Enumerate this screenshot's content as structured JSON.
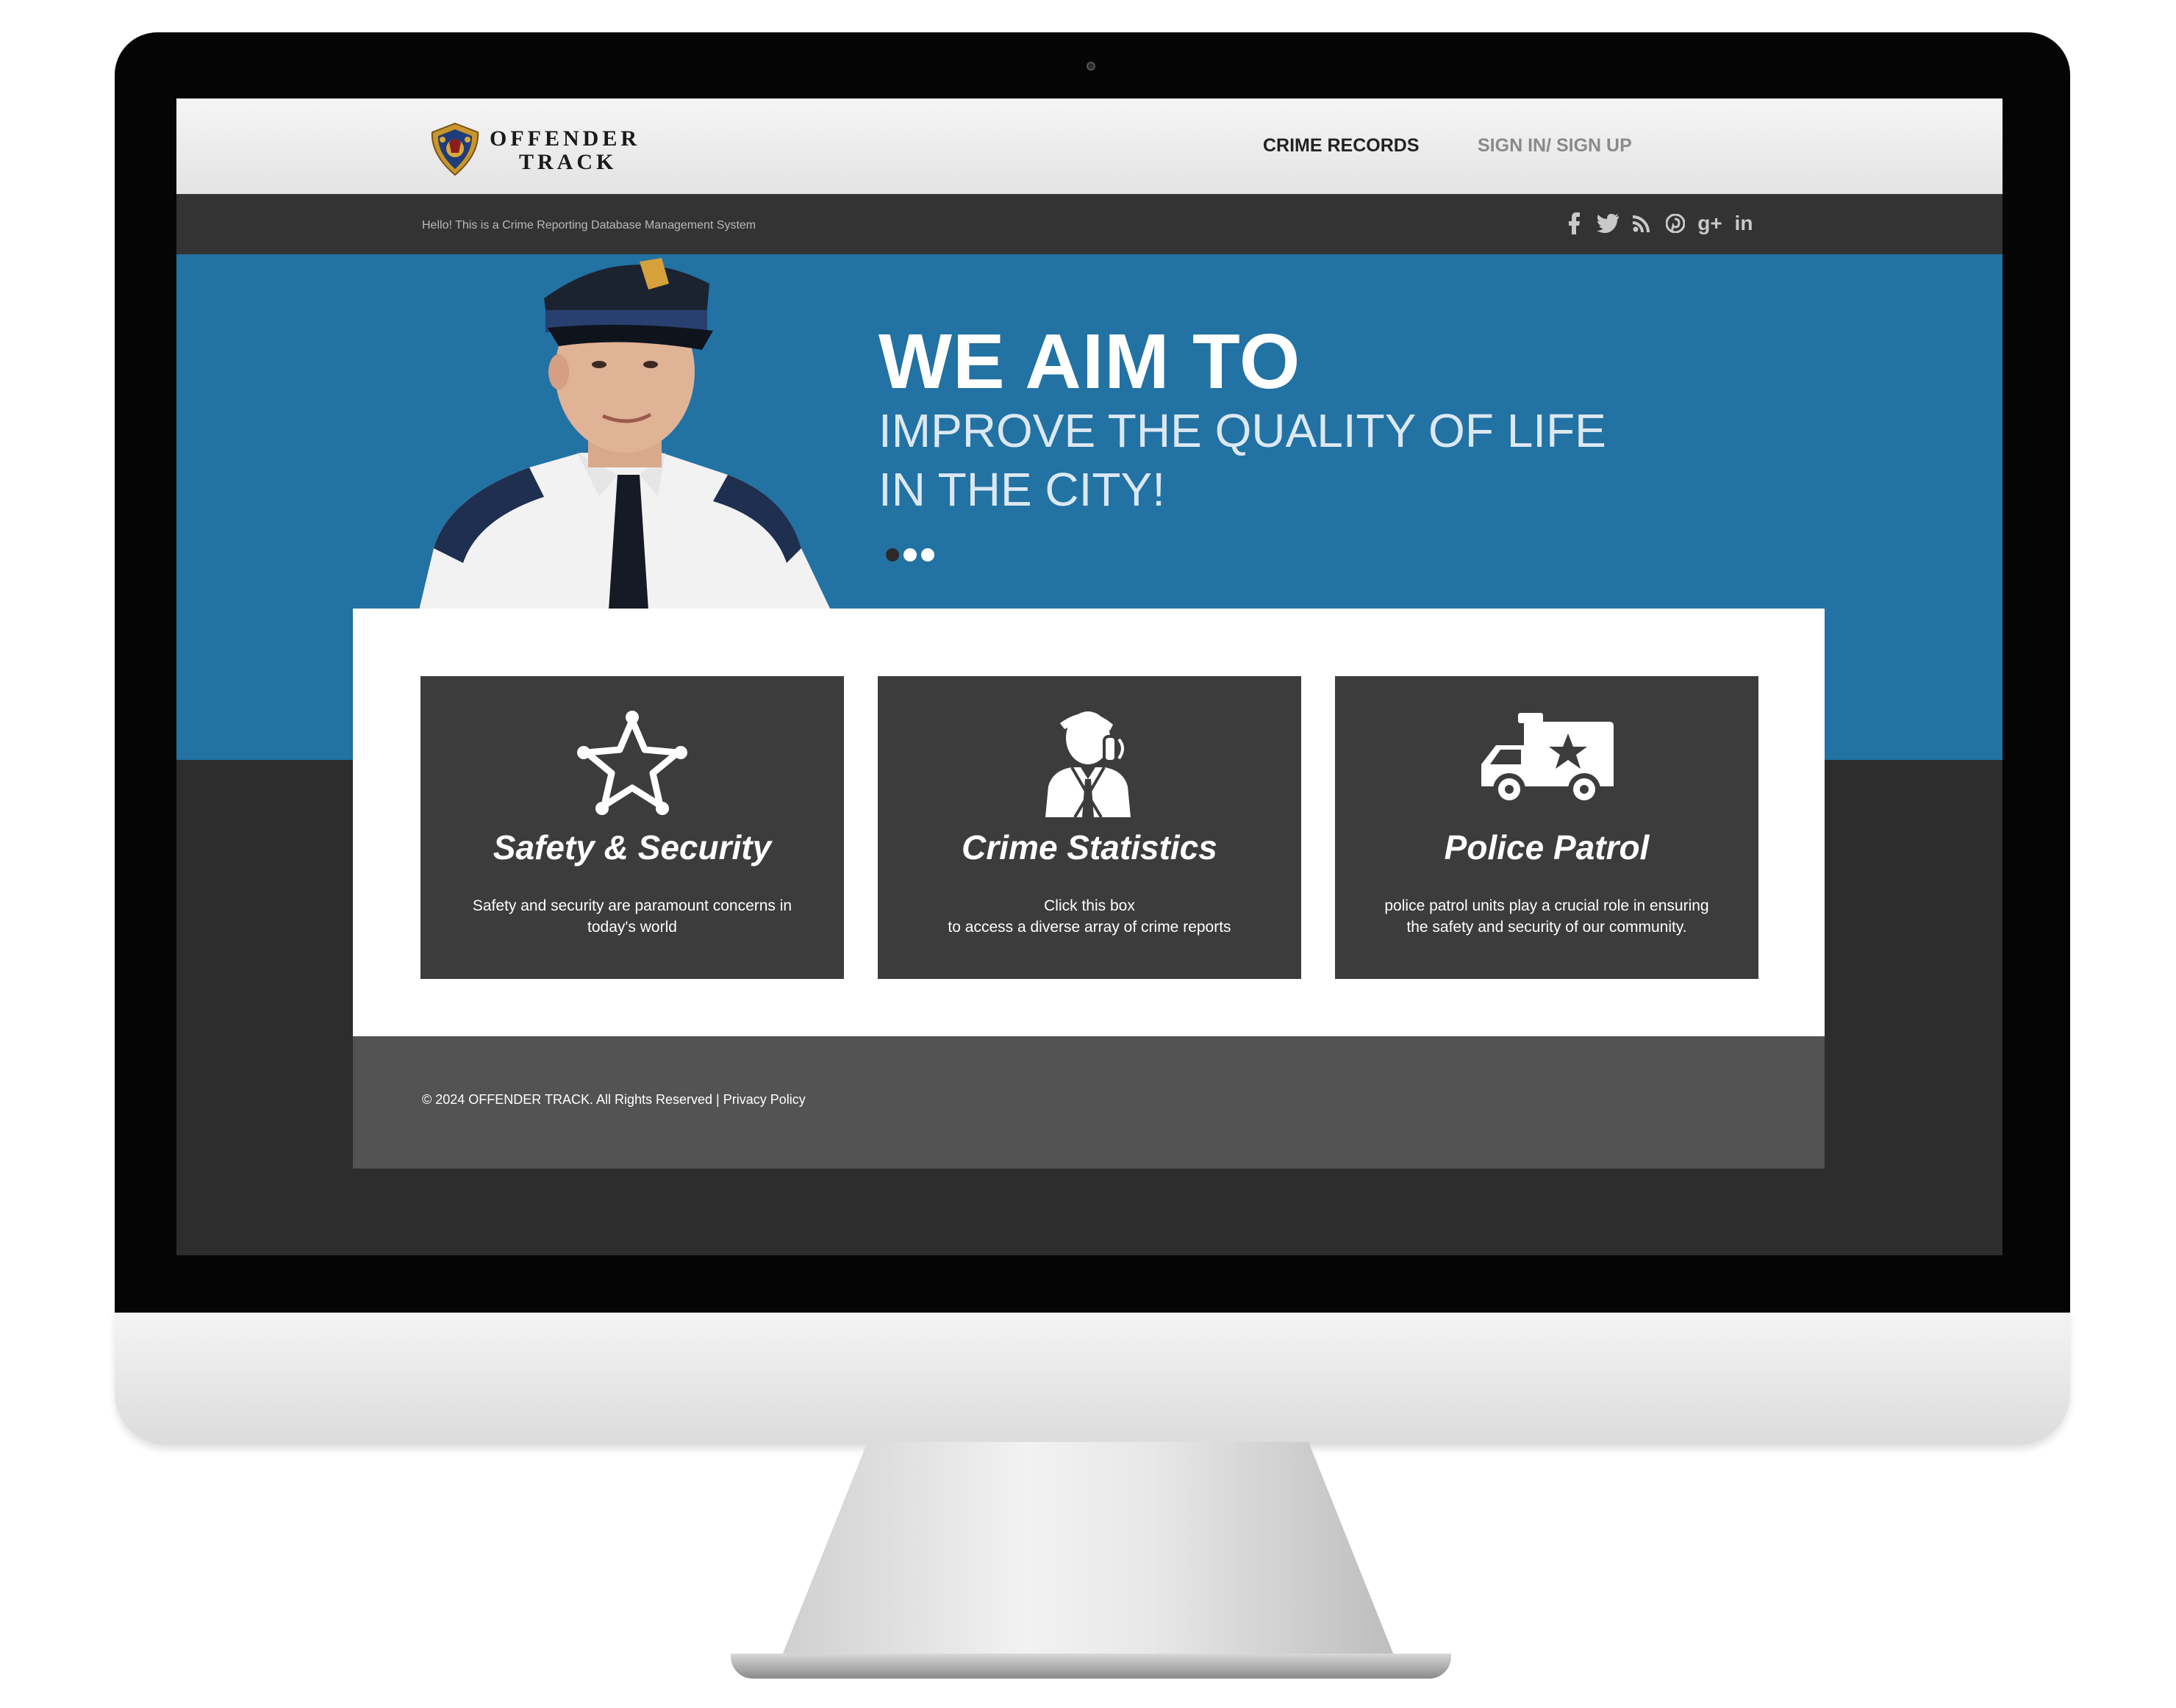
{
  "site": {
    "logo_line1": "OFFENDER",
    "logo_line2": "TRACK"
  },
  "nav": {
    "crime_records": "CRIME RECORDS",
    "sign_in": "SIGN IN/ SIGN UP"
  },
  "topbar": {
    "tagline": "Hello! This is a Crime Reporting Database Management System",
    "social_icons": [
      "facebook-icon",
      "twitter-icon",
      "rss-icon",
      "pinterest-icon",
      "google-plus-icon",
      "linkedin-icon"
    ],
    "googleplus_label": "g+",
    "linkedin_label": "in"
  },
  "hero": {
    "title": "WE AIM TO",
    "subtitle_line1": "IMPROVE THE QUALITY OF LIFE",
    "subtitle_line2": "IN THE CITY!",
    "slides_count": 3,
    "active_slide": 1
  },
  "cards": [
    {
      "icon": "sheriff-star-icon",
      "title": "Safety & Security",
      "desc_line1": "Safety and security are paramount concerns in",
      "desc_line2": "today's world"
    },
    {
      "icon": "businessman-phone-icon",
      "title": "Crime Statistics",
      "desc_line1": "Click this box",
      "desc_line2": "to access a diverse array of crime reports"
    },
    {
      "icon": "police-van-icon",
      "title": "Police Patrol",
      "desc_line1": "police patrol units play a crucial role in ensuring",
      "desc_line2": "the safety and security of our community."
    }
  ],
  "footer": {
    "copyright": "© 2024 OFFENDER TRACK. All Rights Reserved | ",
    "privacy": "Privacy Policy"
  },
  "colors": {
    "hero_blue": "#2272a4",
    "card_dark": "#3c3c3c",
    "footer_gray": "#535353",
    "topbar_dark": "#333333"
  }
}
